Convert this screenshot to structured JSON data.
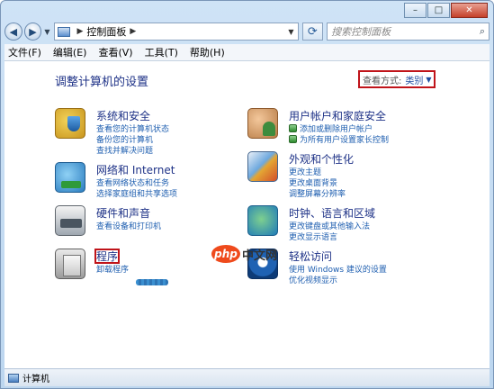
{
  "window": {
    "caption_buttons": {
      "minimize": "–",
      "maximize": "□",
      "close": "✕"
    }
  },
  "address": {
    "back_icon": "back-arrow-icon",
    "forward_icon": "forward-arrow-icon",
    "path": "控制面板",
    "search_placeholder": "搜索控制面板"
  },
  "menu": {
    "items": [
      "文件(F)",
      "编辑(E)",
      "查看(V)",
      "工具(T)",
      "帮助(H)"
    ]
  },
  "content": {
    "title": "调整计算机的设置",
    "view_by_label": "查看方式:",
    "view_by_value": "类别"
  },
  "categories": [
    {
      "title": "系统和安全",
      "icon": "shield-icon",
      "links": [
        "查看您的计算机状态",
        "备份您的计算机",
        "查找并解决问题"
      ]
    },
    {
      "title": "用户帐户和家庭安全",
      "icon": "users-icon",
      "links": [
        "添加或删除用户帐户",
        "为所有用户设置家长控制"
      ]
    },
    {
      "title": "网络和 Internet",
      "icon": "network-icon",
      "links": [
        "查看网络状态和任务",
        "选择家庭组和共享选项"
      ]
    },
    {
      "title": "外观和个性化",
      "icon": "appearance-icon",
      "links": [
        "更改主题",
        "更改桌面背景",
        "调整屏幕分辨率"
      ]
    },
    {
      "title": "硬件和声音",
      "icon": "printer-icon",
      "links": [
        "查看设备和打印机"
      ]
    },
    {
      "title": "时钟、语言和区域",
      "icon": "clock-icon",
      "links": [
        "更改键盘或其他输入法",
        "更改显示语言"
      ]
    },
    {
      "title": "程序",
      "icon": "programs-icon",
      "links": [
        "卸载程序"
      ]
    },
    {
      "title": "轻松访问",
      "icon": "accessibility-icon",
      "links": [
        "使用 Windows 建议的设置",
        "优化视频显示"
      ]
    }
  ],
  "watermark": {
    "logo": "php",
    "text": "中文网"
  },
  "status": {
    "text": "计算机"
  },
  "colors": {
    "highlight_box": "#c0141a",
    "heading": "#1e3287",
    "link": "#1f5fb0"
  }
}
